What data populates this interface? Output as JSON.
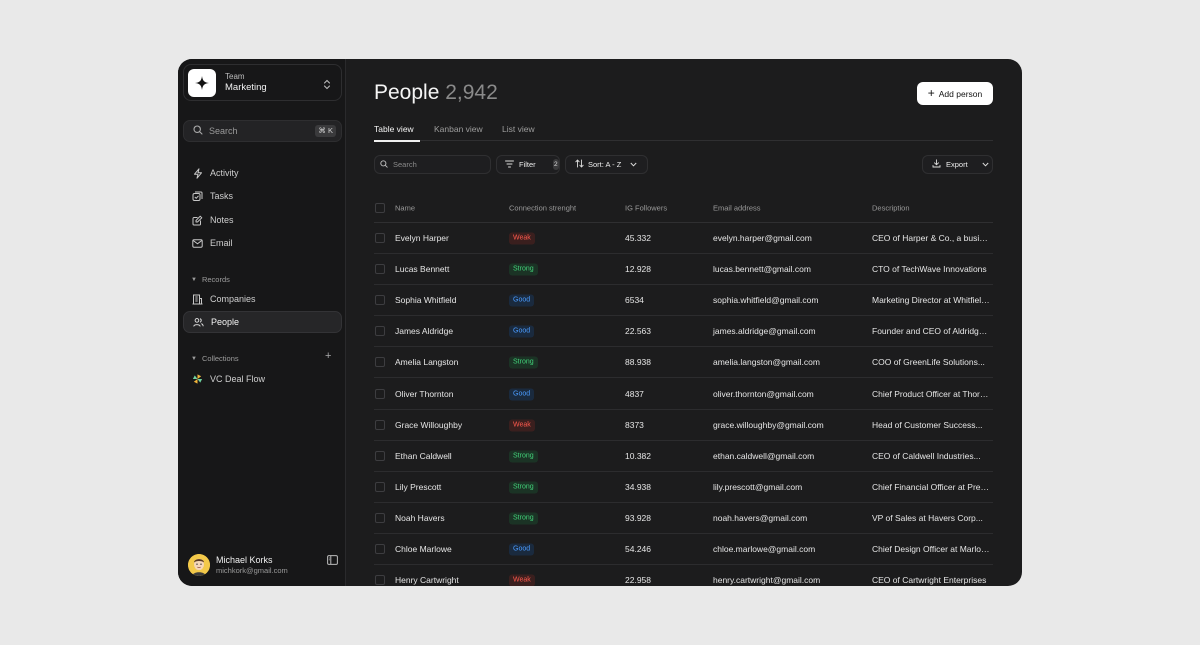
{
  "team": {
    "label": "Team",
    "name": "Marketing"
  },
  "sidebar": {
    "search_label": "Search",
    "search_shortcut": "⌘ K",
    "items": [
      {
        "label": "Activity",
        "icon": "lightning-icon"
      },
      {
        "label": "Tasks",
        "icon": "tasks-icon"
      },
      {
        "label": "Notes",
        "icon": "notes-icon"
      },
      {
        "label": "Email",
        "icon": "mail-icon"
      }
    ],
    "records_label": "Records",
    "records": [
      {
        "label": "Companies",
        "icon": "building-icon"
      },
      {
        "label": "People",
        "icon": "people-icon",
        "active": true
      }
    ],
    "collections_label": "Collections",
    "collections": [
      {
        "label": "VC Deal Flow",
        "icon": "pinwheel-icon"
      }
    ]
  },
  "user": {
    "name": "Michael Korks",
    "email": "michkork@gmail.com"
  },
  "main": {
    "title": "People",
    "count": "2,942",
    "add_label": "Add person",
    "tabs": [
      "Table view",
      "Kanban view",
      "List view"
    ],
    "toolbar": {
      "search_placeholder": "Search",
      "filter_label": "Filter",
      "filter_count": "2",
      "sort_label": "Sort: A - Z",
      "export_label": "Export"
    }
  },
  "table": {
    "columns": [
      "Name",
      "Connection strenght",
      "IG Followers",
      "Email address",
      "Description"
    ],
    "rows": [
      {
        "name": "Evelyn Harper",
        "conn": "Weak",
        "ig": "45.332",
        "email": "evelyn.harper@gmail.com",
        "desc": "CEO of Harper & Co., a business consultancy"
      },
      {
        "name": "Lucas Bennett",
        "conn": "Strong",
        "ig": "12.928",
        "email": "lucas.bennett@gmail.com",
        "desc": "CTO of TechWave Innovations"
      },
      {
        "name": "Sophia Whitfield",
        "conn": "Good",
        "ig": "6534",
        "email": "sophia.whitfield@gmail.com",
        "desc": "Marketing Director at Whitfield Media"
      },
      {
        "name": "James Aldridge",
        "conn": "Good",
        "ig": "22.563",
        "email": "james.aldridge@gmail.com",
        "desc": "Founder and CEO of Aldridge Ventures"
      },
      {
        "name": "Amelia Langston",
        "conn": "Strong",
        "ig": "88.938",
        "email": "amelia.langston@gmail.com",
        "desc": "COO of GreenLife Solutions..."
      },
      {
        "name": "Oliver Thornton",
        "conn": "Good",
        "ig": "4837",
        "email": "oliver.thornton@gmail.com",
        "desc": "Chief Product Officer at Thornton Labs"
      },
      {
        "name": "Grace Willoughby",
        "conn": "Weak",
        "ig": "8373",
        "email": "grace.willoughby@gmail.com",
        "desc": "Head of Customer Success..."
      },
      {
        "name": "Ethan Caldwell",
        "conn": "Strong",
        "ig": "10.382",
        "email": "ethan.caldwell@gmail.com",
        "desc": "CEO of Caldwell Industries..."
      },
      {
        "name": "Lily Prescott",
        "conn": "Strong",
        "ig": "34.938",
        "email": "lily.prescott@gmail.com",
        "desc": "Chief Financial Officer at Prescott Group"
      },
      {
        "name": "Noah Havers",
        "conn": "Strong",
        "ig": "93.928",
        "email": "noah.havers@gmail.com",
        "desc": "VP of Sales at Havers Corp..."
      },
      {
        "name": "Chloe Marlowe",
        "conn": "Good",
        "ig": "54.246",
        "email": "chloe.marlowe@gmail.com",
        "desc": "Chief Design Officer at Marlowe Studio"
      },
      {
        "name": "Henry Cartwright",
        "conn": "Weak",
        "ig": "22.958",
        "email": "henry.cartwright@gmail.com",
        "desc": "CEO of Cartwright Enterprises"
      }
    ]
  }
}
